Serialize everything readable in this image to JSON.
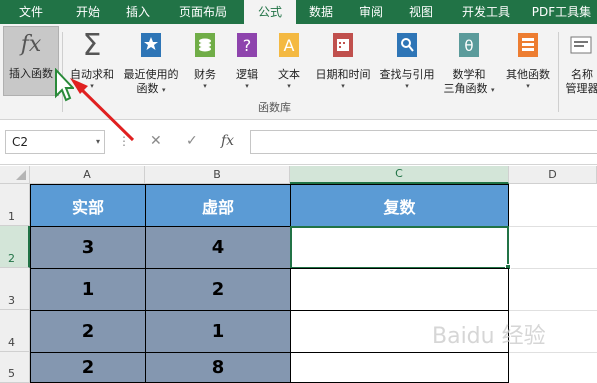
{
  "tabs": [
    "文件",
    "开始",
    "插入",
    "页面布局",
    "公式",
    "数据",
    "审阅",
    "视图",
    "开发工具",
    "PDF工具集"
  ],
  "active_tab_index": 4,
  "ribbon": {
    "buttons": [
      {
        "label": "插入函数",
        "icon": "fx-icon"
      },
      {
        "label": "自动求和",
        "icon": "sigma-icon",
        "caret": "▾"
      },
      {
        "label": "最近使用的",
        "label2": "函数",
        "icon": "star-book-icon",
        "caret": "▾"
      },
      {
        "label": "财务",
        "icon": "finance-book-icon",
        "caret": "▾"
      },
      {
        "label": "逻辑",
        "icon": "question-book-icon",
        "caret": "▾"
      },
      {
        "label": "文本",
        "icon": "text-book-icon",
        "caret": "▾"
      },
      {
        "label": "日期和时间",
        "icon": "calendar-book-icon",
        "caret": "▾"
      },
      {
        "label": "查找与引用",
        "icon": "lookup-book-icon",
        "caret": "▾"
      },
      {
        "label": "数学和",
        "label2": "三角函数",
        "icon": "theta-book-icon",
        "caret": "▾"
      },
      {
        "label": "其他函数",
        "icon": "more-functions-icon",
        "caret": "▾"
      },
      {
        "label": "名称",
        "label2": "管理器",
        "icon": "name-manager-icon"
      }
    ],
    "group_label": "函数库"
  },
  "formula_bar": {
    "name_box": "C2",
    "dropdown": "▾",
    "dots": "⋮",
    "cancel": "✕",
    "enter": "✓",
    "fx": "fx",
    "formula": ""
  },
  "columns": [
    "A",
    "B",
    "C",
    "D"
  ],
  "selected_column": "C",
  "rows": [
    "1",
    "2",
    "3",
    "4",
    "5"
  ],
  "selected_row": "2",
  "table": {
    "headers": [
      "实部",
      "虚部",
      "复数"
    ],
    "data": [
      [
        "3",
        "4",
        ""
      ],
      [
        "1",
        "2",
        ""
      ],
      [
        "2",
        "1",
        ""
      ],
      [
        "2",
        "8",
        ""
      ]
    ]
  },
  "colors": {
    "ribbon_green": "#217346",
    "header_blue": "#5b9bd5",
    "data_gray_blue": "#8497b0",
    "arrow_red": "#e02020"
  },
  "watermark": "Baidu 经验"
}
